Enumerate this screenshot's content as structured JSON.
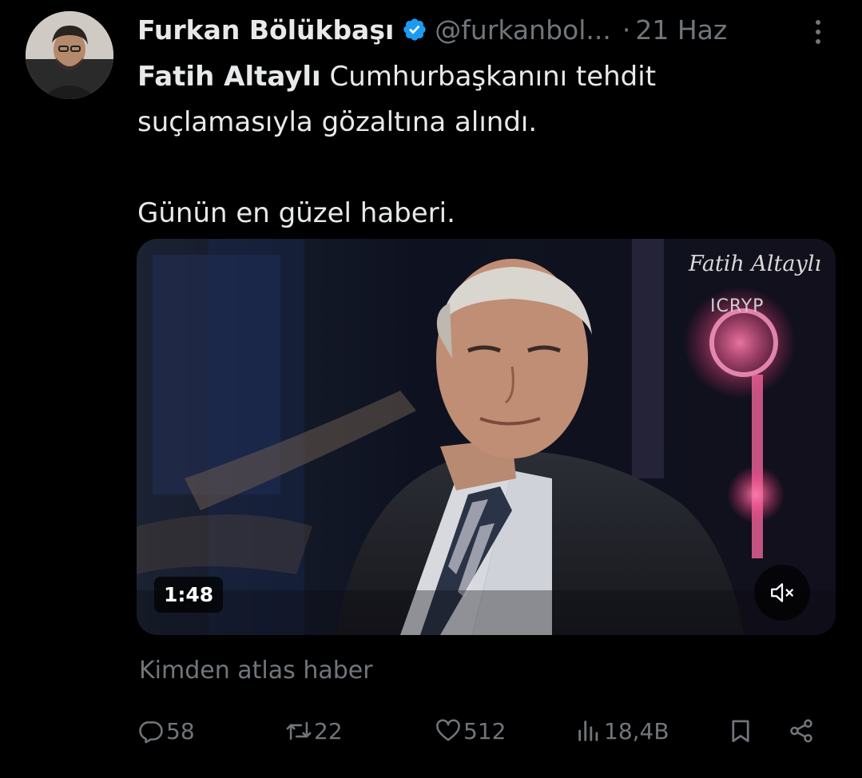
{
  "author": {
    "display_name": "Furkan Bölükbaşı",
    "handle": "@furkanbol...",
    "separator": "·",
    "date": "21 Haz"
  },
  "tweet": {
    "mention": "Fatih Altaylı",
    "line1_rest": " Cumhurbaşkanını tehdit",
    "line2": "suçlamasıyla gözaltına alındı.",
    "line3": "Günün en güzel haberi."
  },
  "media": {
    "watermark_name": "Fatih Altaylı",
    "watermark_brand": "ICRYP",
    "duration": "1:48"
  },
  "source_text": "Kimden atlas haber",
  "actions": {
    "replies": "58",
    "reposts": "22",
    "likes": "512",
    "views": "18,4B"
  },
  "icons": {
    "avatar": "avatar-image",
    "verified": "verified-badge-icon",
    "more": "more-options-icon",
    "mute": "mute-icon",
    "reply": "reply-icon",
    "repost": "repost-icon",
    "like": "heart-icon",
    "views": "views-icon",
    "bookmark": "bookmark-icon",
    "share": "share-icon"
  },
  "colors": {
    "background": "#000000",
    "text": "#e7e9ea",
    "secondary": "#71767b",
    "verified": "#1d9bf0"
  }
}
